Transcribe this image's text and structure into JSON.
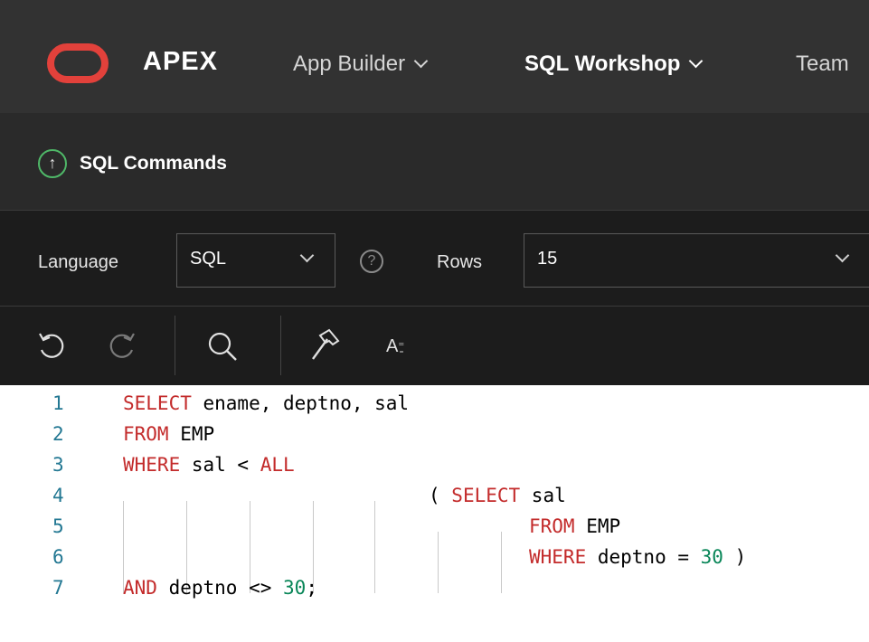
{
  "nav": {
    "brand": "APEX",
    "items": [
      {
        "label": "App Builder"
      },
      {
        "label": "SQL Workshop"
      },
      {
        "label": "Team"
      }
    ]
  },
  "header": {
    "title": "SQL Commands"
  },
  "settings": {
    "language_label": "Language",
    "language_value": "SQL",
    "rows_label": "Rows",
    "rows_value": "15",
    "help_glyph": "?"
  },
  "toolbar": {
    "icons": [
      "undo-icon",
      "redo-icon",
      "search-icon",
      "hammer-icon",
      "autocomplete-icon"
    ],
    "autocomplete_glyph": "A"
  },
  "editor": {
    "line_numbers": [
      "1",
      "2",
      "3",
      "4",
      "5",
      "6",
      "7"
    ],
    "lines": [
      [
        {
          "t": "SELECT",
          "c": "kw"
        },
        {
          "t": " ename, deptno, sal",
          "c": ""
        }
      ],
      [
        {
          "t": "FROM",
          "c": "kw"
        },
        {
          "t": " EMP",
          "c": ""
        }
      ],
      [
        {
          "t": "WHERE",
          "c": "kw"
        },
        {
          "t": " sal < ",
          "c": ""
        },
        {
          "t": "ALL",
          "c": "kw"
        }
      ],
      [
        {
          "t": "( ",
          "c": ""
        },
        {
          "t": "SELECT",
          "c": "kw"
        },
        {
          "t": " sal",
          "c": ""
        }
      ],
      [
        {
          "t": "FROM",
          "c": "kw"
        },
        {
          "t": " EMP",
          "c": ""
        }
      ],
      [
        {
          "t": "WHERE",
          "c": "kw"
        },
        {
          "t": " deptno = ",
          "c": ""
        },
        {
          "t": "30",
          "c": "num"
        },
        {
          "t": " )",
          "c": ""
        }
      ],
      [
        {
          "t": "AND",
          "c": "kw"
        },
        {
          "t": " deptno <> ",
          "c": ""
        },
        {
          "t": "30",
          "c": "num"
        },
        {
          "t": ";",
          "c": ""
        }
      ]
    ]
  }
}
